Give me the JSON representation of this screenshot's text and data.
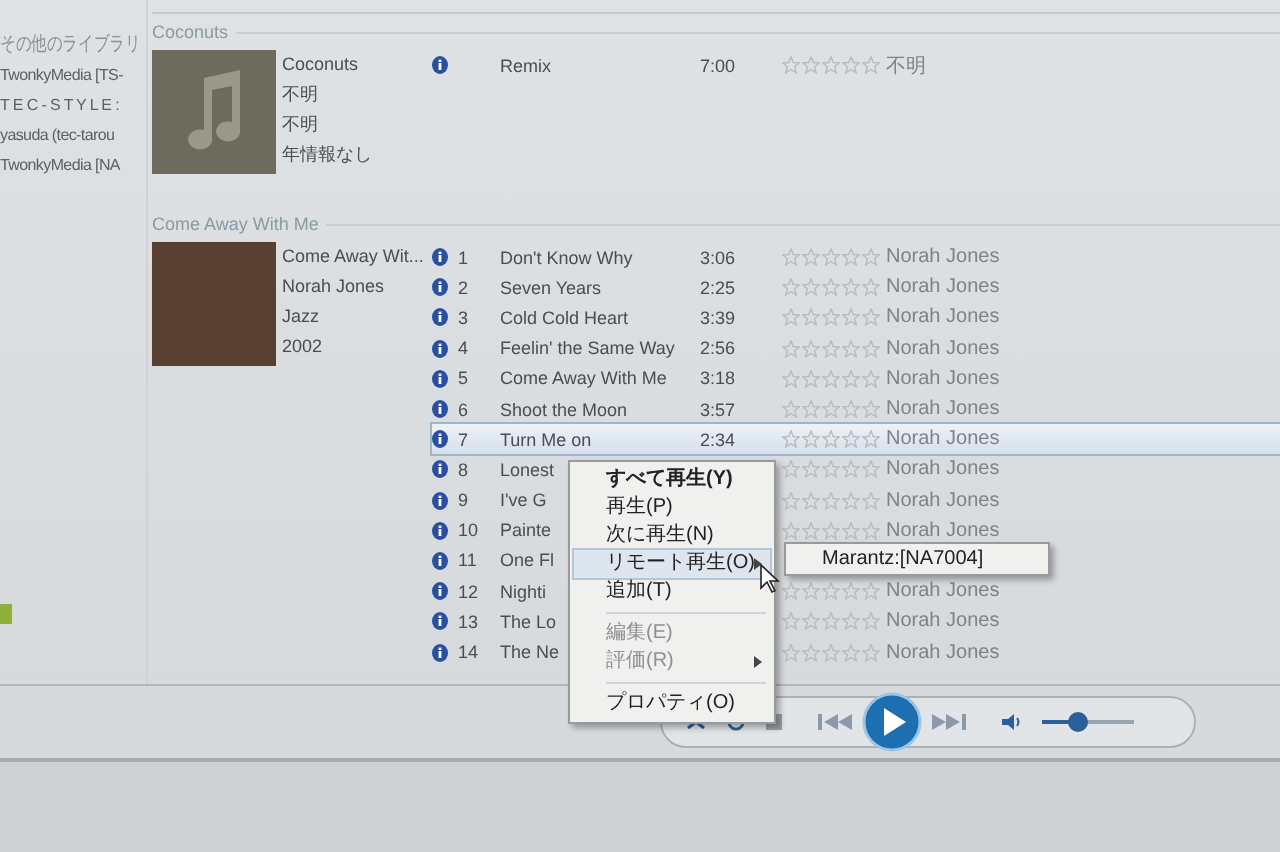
{
  "sidebar": {
    "heading": "その他のライブラリ",
    "items": [
      {
        "label": "TwonkyMedia [TS-"
      },
      {
        "label": "T E C - S T Y L E :"
      },
      {
        "label": "yasuda (tec-tarou"
      },
      {
        "label": "TwonkyMedia [NA"
      }
    ]
  },
  "albums": [
    {
      "group": "Coconuts",
      "kind": "placeholder",
      "info": [
        "Coconuts",
        "不明",
        "不明",
        "年情報なし"
      ],
      "tracks": [
        {
          "title": "Remix",
          "length": "7:00",
          "stars": 0,
          "artist": "不明",
          "selected": false
        }
      ]
    },
    {
      "group": "Come Away With Me",
      "kind": "photo",
      "info": [
        "Come Away Wit...",
        "Norah Jones",
        "Jazz",
        "2002"
      ],
      "tracks": [
        {
          "number": "1",
          "title": "Don't Know Why",
          "length": "3:06",
          "stars": 0,
          "artist": "Norah Jones",
          "selected": false
        },
        {
          "number": "2",
          "title": "Seven Years",
          "length": "2:25",
          "stars": 0,
          "artist": "Norah Jones",
          "selected": false
        },
        {
          "number": "3",
          "title": "Cold Cold Heart",
          "length": "3:39",
          "stars": 0,
          "artist": "Norah Jones",
          "selected": false
        },
        {
          "number": "4",
          "title": "Feelin' the Same Way",
          "length": "2:56",
          "stars": 0,
          "artist": "Norah Jones",
          "selected": false
        },
        {
          "number": "5",
          "title": "Come Away With Me",
          "length": "3:18",
          "stars": 0,
          "artist": "Norah Jones",
          "selected": false
        },
        {
          "number": "6",
          "title": "Shoot the Moon",
          "length": "3:57",
          "stars": 0,
          "artist": "Norah Jones",
          "selected": false
        },
        {
          "number": "7",
          "title": "Turn Me on",
          "length": "2:34",
          "stars": 0,
          "artist": "Norah Jones",
          "selected": true
        },
        {
          "number": "8",
          "title": "Lonest",
          "stars": 0,
          "artist": "Norah Jones",
          "selected": false
        },
        {
          "number": "9",
          "title": "I've G",
          "stars": 0,
          "artist": "Norah Jones",
          "selected": false
        },
        {
          "number": "10",
          "title": "Painte",
          "stars": 0,
          "artist": "Norah Jones",
          "selected": false
        },
        {
          "number": "11",
          "title": "One Fl",
          "selected": false
        },
        {
          "number": "12",
          "title": "Nighti",
          "stars": 0,
          "artist": "Norah Jones",
          "selected": false
        },
        {
          "number": "13",
          "title": "The Lo",
          "stars": 0,
          "artist": "Norah Jones",
          "selected": false
        },
        {
          "number": "14",
          "title": "The Ne",
          "stars": 0,
          "artist": "Norah Jones",
          "selected": false
        }
      ]
    }
  ],
  "context_menu": {
    "items": [
      {
        "kind": "item",
        "label": "すべて再生(Y)",
        "bold": true,
        "disabled": false,
        "selected": false,
        "submenu": false
      },
      {
        "kind": "item",
        "label": "再生(P)",
        "bold": false,
        "disabled": false,
        "selected": false,
        "submenu": false
      },
      {
        "kind": "item",
        "label": "次に再生(N)",
        "bold": false,
        "disabled": false,
        "selected": false,
        "submenu": false
      },
      {
        "kind": "item",
        "label": "リモート再生(O)",
        "bold": false,
        "disabled": false,
        "selected": true,
        "submenu": true
      },
      {
        "kind": "item",
        "label": "追加(T)",
        "bold": false,
        "disabled": false,
        "selected": false,
        "submenu": false
      },
      {
        "kind": "separator"
      },
      {
        "kind": "item",
        "label": "編集(E)",
        "bold": false,
        "disabled": true,
        "selected": false,
        "submenu": false
      },
      {
        "kind": "item",
        "label": "評価(R)",
        "bold": false,
        "disabled": true,
        "selected": false,
        "submenu": true
      },
      {
        "kind": "separator"
      },
      {
        "kind": "item",
        "label": "プロパティ(O)",
        "bold": false,
        "disabled": false,
        "selected": false,
        "submenu": false
      }
    ]
  },
  "submenu": {
    "items": [
      {
        "label": "Marantz:[NA7004]"
      }
    ]
  },
  "player": {
    "volume": {
      "level": 0.4
    }
  }
}
